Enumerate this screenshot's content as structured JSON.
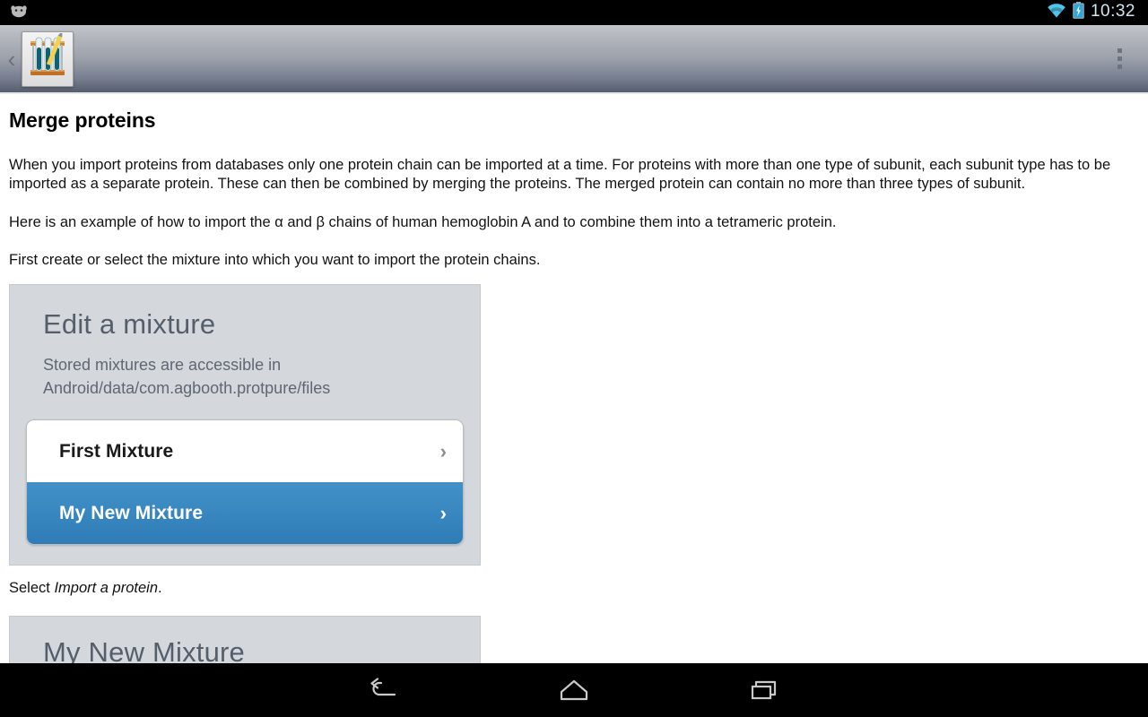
{
  "statusbar": {
    "notification_icon": "android-notification-icon",
    "wifi_icon": "wifi-icon",
    "battery_icon": "battery-charging-icon",
    "clock": "10:32"
  },
  "actionbar": {
    "back_chevron": "‹",
    "app_icon": "test-tube-rack-icon",
    "overflow": "overflow-menu-icon"
  },
  "page": {
    "title": "Merge proteins",
    "paragraphs": [
      "When you import proteins from databases only one protein chain can be imported at a time. For proteins with more than one type of subunit, each subunit type has to be imported as a separate protein. These can then be combined by merging the proteins. The merged protein can contain no more than three types of subunit.",
      "Here is an example of how to import the α and β chains of human hemoglobin A and to combine them into a tetrameric protein.",
      "First create or select the mixture into which you want to import the protein chains."
    ],
    "select_line_prefix": "Select ",
    "select_line_italic": "Import a protein",
    "select_line_suffix": "."
  },
  "screenshot_card": {
    "title": "Edit a mixture",
    "subtitle": "Stored mixtures are accessible in Android/data/com.agbooth.protpure/files",
    "list": [
      {
        "label": "First Mixture",
        "selected": false,
        "chevron": "›"
      },
      {
        "label": "My New Mixture",
        "selected": true,
        "chevron": "›"
      }
    ]
  },
  "screenshot_card_2": {
    "title": "My New Mixture"
  },
  "navbar": {
    "back": "back-icon",
    "home": "home-icon",
    "recents": "recents-icon"
  },
  "colors": {
    "accent_blue": "#3b8ac2",
    "card_bg": "#d4d7dc",
    "actionbar_top": "#c2c5ca",
    "actionbar_bottom": "#585f71",
    "status_clock": "#cfe8f2"
  }
}
